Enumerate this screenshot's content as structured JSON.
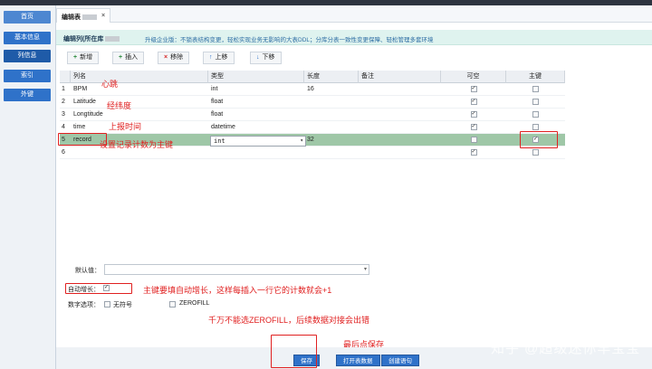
{
  "sidebar": {
    "items": [
      {
        "label": "首页"
      },
      {
        "label": "基本信息"
      },
      {
        "label": "列信息"
      },
      {
        "label": "索引"
      },
      {
        "label": "外键"
      }
    ]
  },
  "tab": {
    "label": "编辑表",
    "close": "×"
  },
  "banner": {
    "title": "编辑列(所在库",
    "note": "升级企业版：不锁表结构变更，轻松实现业务无影响的大表DDL；分库分表一致性变更保障、轻松管理多套环境"
  },
  "toolbar": {
    "add": {
      "icon": "+",
      "label": "新增"
    },
    "insert": {
      "icon": "+",
      "label": "插入"
    },
    "remove": {
      "icon": "×",
      "label": "移除"
    },
    "up": {
      "icon": "↑",
      "label": "上移"
    },
    "down": {
      "icon": "↓",
      "label": "下移"
    }
  },
  "columns": {
    "headers": {
      "name": "列名",
      "type": "类型",
      "length": "长度",
      "note": "备注",
      "nullable": "可空",
      "pk": "主键"
    },
    "rows": [
      {
        "num": "1",
        "name": "BPM",
        "type": "int",
        "length": "16",
        "nullable": "✓",
        "pk": ""
      },
      {
        "num": "2",
        "name": "Latitude",
        "type": "float",
        "length": "",
        "nullable": "✓",
        "pk": ""
      },
      {
        "num": "3",
        "name": "Longtitude",
        "type": "float",
        "length": "",
        "nullable": "✓",
        "pk": ""
      },
      {
        "num": "4",
        "name": "time",
        "type": "datetime",
        "length": "",
        "nullable": "✓",
        "pk": ""
      },
      {
        "num": "5",
        "name": "record",
        "type": "int",
        "length": "32",
        "nullable": "",
        "pk": "✓"
      },
      {
        "num": "6",
        "name": "",
        "type": "",
        "length": "",
        "nullable": "✓",
        "pk": ""
      }
    ],
    "type_dropdown_arrow": "▾"
  },
  "annotations": {
    "bpm": "心跳",
    "latlng": "经纬度",
    "time": "上报时间",
    "record": "设置记录计数为主键",
    "autoinc": "主键要填自动增长，这样每插入一行它的计数就会+1",
    "zerofill": "千万不能选ZEROFILL，后续数据对接会出错",
    "save": "最后点保存"
  },
  "props": {
    "default_label": "默认值：",
    "default_arrow": "▾",
    "autoinc_label": "自动增长：",
    "autoinc_check": "✓",
    "numeric_label": "数字选项：",
    "unsigned_label": "无符号",
    "zerofill_label": "ZEROFILL"
  },
  "footer": {
    "save": "保存",
    "open_data": "打开表数据",
    "create_sql": "创建语句"
  },
  "watermark": "知乎 @超级迷你羊宝宝"
}
